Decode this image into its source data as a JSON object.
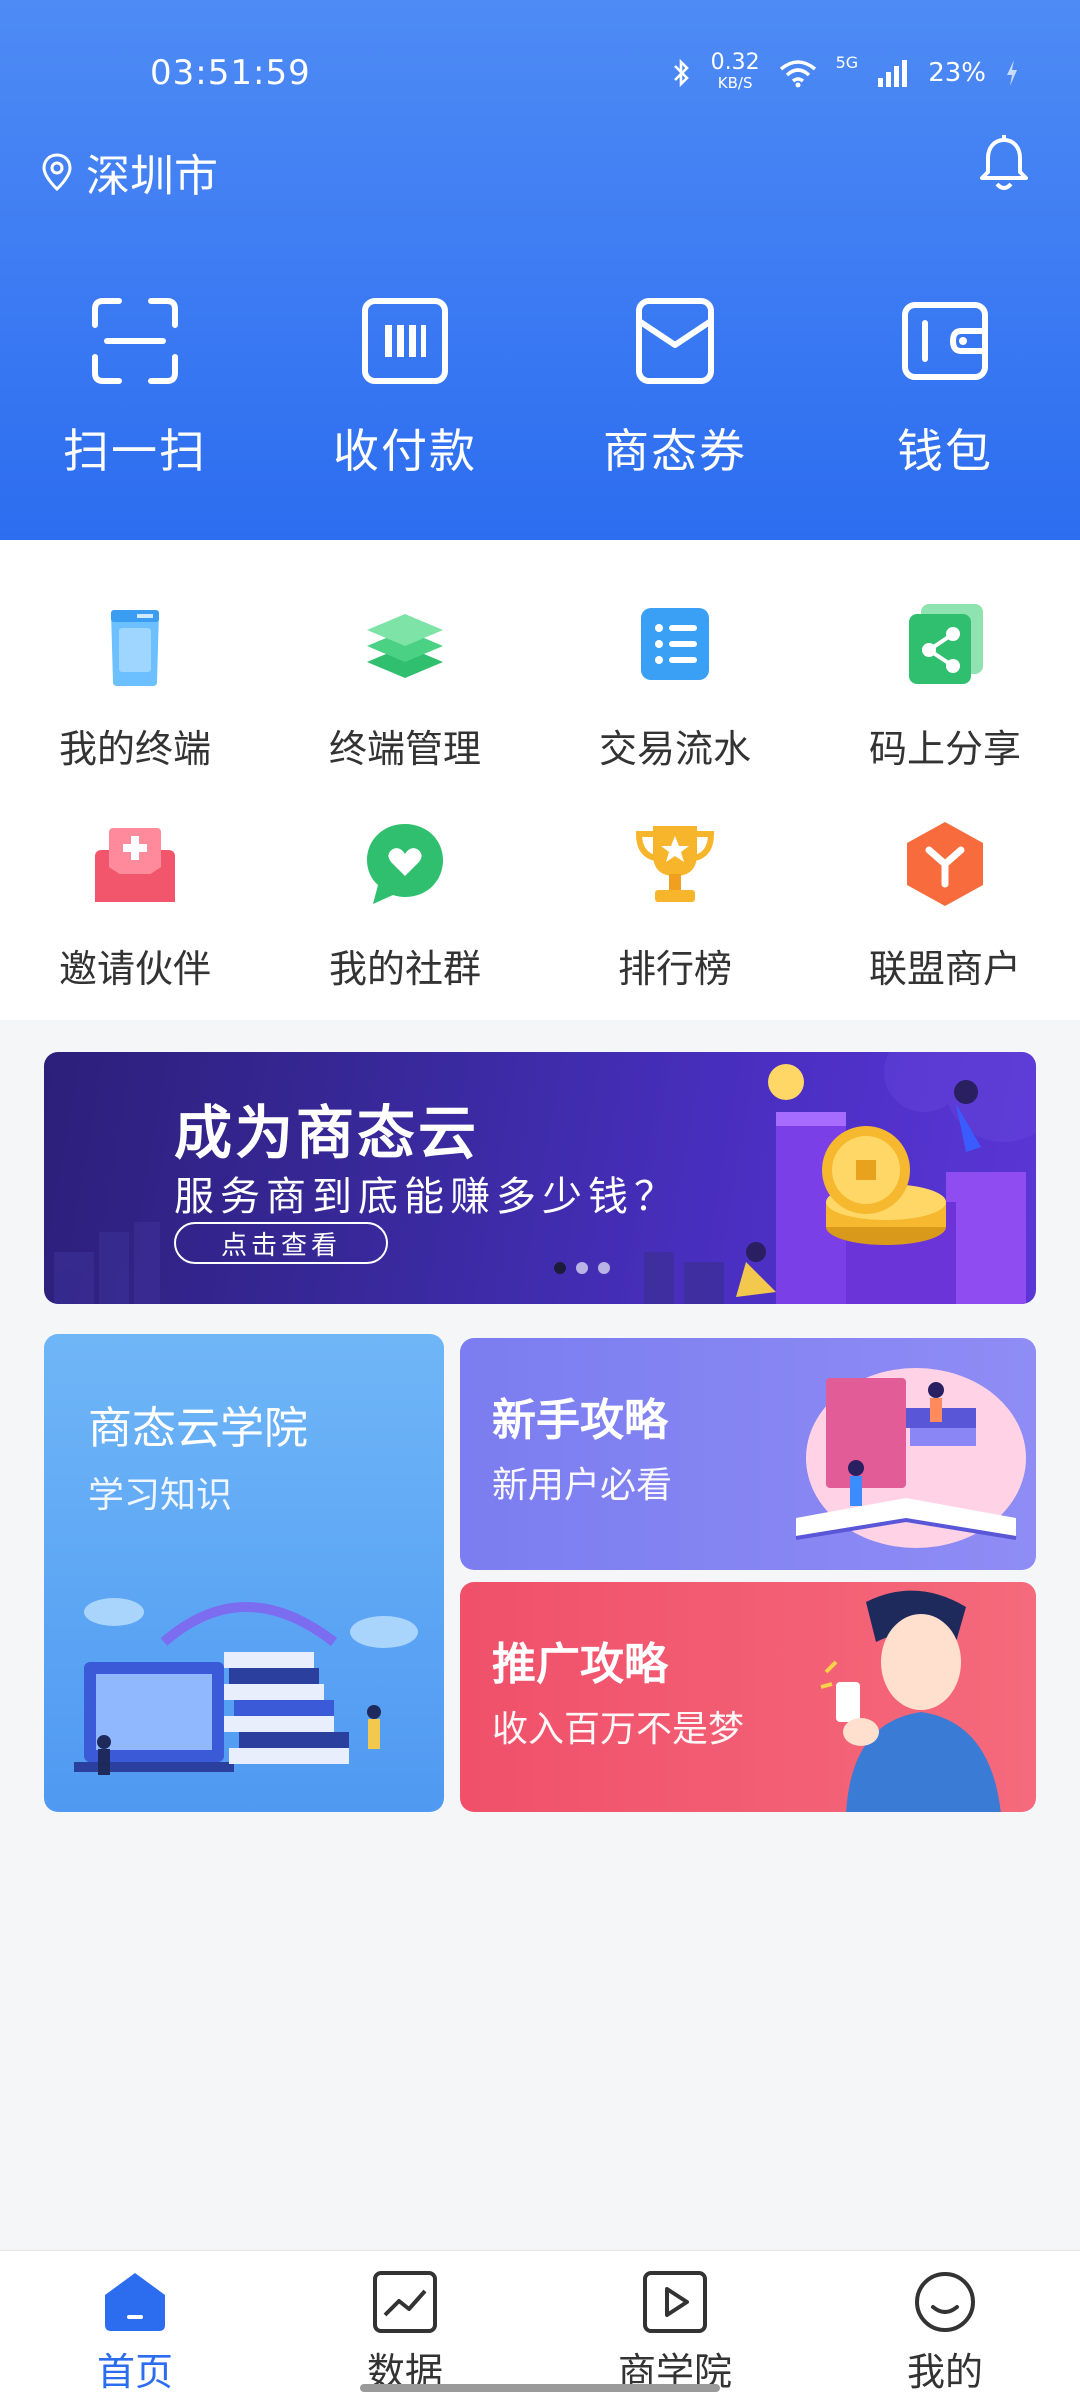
{
  "status": {
    "time": "03:51:59",
    "speed_value": "0.32",
    "speed_unit": "KB/S",
    "network": "5G",
    "battery": "23%"
  },
  "header": {
    "location": "深圳市"
  },
  "quick_actions": [
    {
      "label": "扫一扫",
      "icon": "scan-icon"
    },
    {
      "label": "收付款",
      "icon": "payment-code-icon"
    },
    {
      "label": "商态券",
      "icon": "coupon-icon"
    },
    {
      "label": "钱包",
      "icon": "wallet-icon"
    }
  ],
  "grid": [
    {
      "label": "我的终端",
      "icon": "terminal-icon"
    },
    {
      "label": "终端管理",
      "icon": "layers-icon"
    },
    {
      "label": "交易流水",
      "icon": "list-icon"
    },
    {
      "label": "码上分享",
      "icon": "share-icon"
    },
    {
      "label": "邀请伙伴",
      "icon": "invite-icon"
    },
    {
      "label": "我的社群",
      "icon": "community-icon"
    },
    {
      "label": "排行榜",
      "icon": "trophy-icon"
    },
    {
      "label": "联盟商户",
      "icon": "alliance-icon"
    }
  ],
  "banner": {
    "title": "成为商态云",
    "subtitle": "服务商到底能赚多少钱？",
    "button": "点击查看",
    "slides": 3,
    "active": 0
  },
  "cards": {
    "academy": {
      "title": "商态云学院",
      "subtitle": "学习知识"
    },
    "newbie": {
      "title": "新手攻略",
      "subtitle": "新用户必看"
    },
    "promo": {
      "title": "推广攻略",
      "subtitle": "收入百万不是梦"
    }
  },
  "nav": [
    {
      "label": "首页",
      "icon": "home-icon",
      "active": true
    },
    {
      "label": "数据",
      "icon": "chart-icon",
      "active": false
    },
    {
      "label": "商学院",
      "icon": "play-icon",
      "active": false
    },
    {
      "label": "我的",
      "icon": "profile-icon",
      "active": false
    }
  ],
  "colors": {
    "primary": "#2c6df0",
    "newbie": "#8886f3",
    "promo": "#f2566d",
    "academy": "#5ea6f4"
  }
}
